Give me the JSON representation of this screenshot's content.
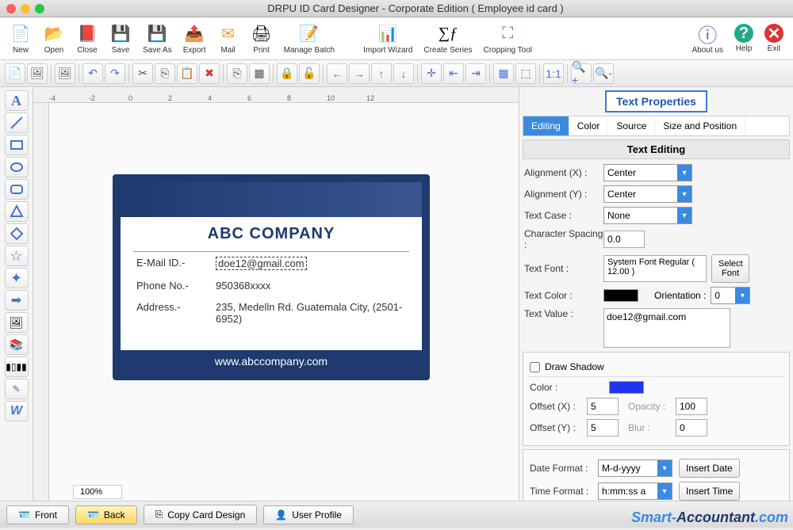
{
  "title": "DRPU ID Card Designer - Corporate Edition ( Employee id card )",
  "toolbar": [
    {
      "label": "New",
      "icon": "📄"
    },
    {
      "label": "Open",
      "icon": "📂"
    },
    {
      "label": "Close",
      "icon": "✖"
    },
    {
      "label": "Save",
      "icon": "💾"
    },
    {
      "label": "Save As",
      "icon": "💾"
    },
    {
      "label": "Export",
      "icon": "📤"
    },
    {
      "label": "Mail",
      "icon": "✉"
    },
    {
      "label": "Print",
      "icon": "🖨"
    },
    {
      "label": "Manage Batch",
      "icon": "📝"
    },
    {
      "label": "Import Wizard",
      "icon": "📊"
    },
    {
      "label": "Create Series",
      "icon": "∑ƒ"
    },
    {
      "label": "Cropping Tool",
      "icon": "✂"
    }
  ],
  "toolbar_right": [
    {
      "label": "About us",
      "icon": "ℹ"
    },
    {
      "label": "Help",
      "icon": "?"
    },
    {
      "label": "Exit",
      "icon": "✖"
    }
  ],
  "ruler": [
    "-4",
    "-2",
    "0",
    "2",
    "4",
    "6",
    "8",
    "10",
    "12"
  ],
  "zoom": "100%",
  "card": {
    "company": "ABC COMPANY",
    "email_k": "E-Mail ID.-",
    "email_v": "doe12@gmail.com",
    "phone_k": "Phone No.-",
    "phone_v": "950368xxxx",
    "addr_k": "Address.-",
    "addr_v": "235, Medelln Rd. Guatemala City, (2501-6952)",
    "url": "www.abccompany.com"
  },
  "props": {
    "title": "Text Properties",
    "tabs": {
      "editing": "Editing",
      "color": "Color",
      "source": "Source",
      "size": "Size and Position"
    },
    "section": "Text Editing",
    "alignx_l": "Alignment (X) :",
    "alignx_v": "Center",
    "aligny_l": "Alignment (Y) :",
    "aligny_v": "Center",
    "case_l": "Text Case :",
    "case_v": "None",
    "spacing_l": "Character Spacing :",
    "spacing_v": "0.0",
    "font_l": "Text Font :",
    "font_v": "System Font Regular ( 12.00 )",
    "selfont": "Select Font",
    "color_l": "Text Color :",
    "color_v": "#000000",
    "orient_l": "Orientation :",
    "orient_v": "0",
    "value_l": "Text Value :",
    "value_v": "doe12@gmail.com",
    "shadow_l": "Draw Shadow",
    "scolor_l": "Color :",
    "scolor_v": "#2233ee",
    "offx_l": "Offset (X) :",
    "offx_v": "5",
    "offy_l": "Offset (Y) :",
    "offy_v": "5",
    "opac_l": "Opacity :",
    "opac_v": "100",
    "blur_l": "Blur :",
    "blur_v": "0",
    "datef_l": "Date Format :",
    "datef_v": "M-d-yyyy",
    "insdate": "Insert Date",
    "timef_l": "Time Format :",
    "timef_v": "h:mm:ss a",
    "instime": "Insert Time"
  },
  "bottom": {
    "front": "Front",
    "back": "Back",
    "copy": "Copy Card Design",
    "profile": "User Profile"
  },
  "watermark": {
    "a": "Smart-",
    "b": "Accountant",
    "c": ".com"
  }
}
